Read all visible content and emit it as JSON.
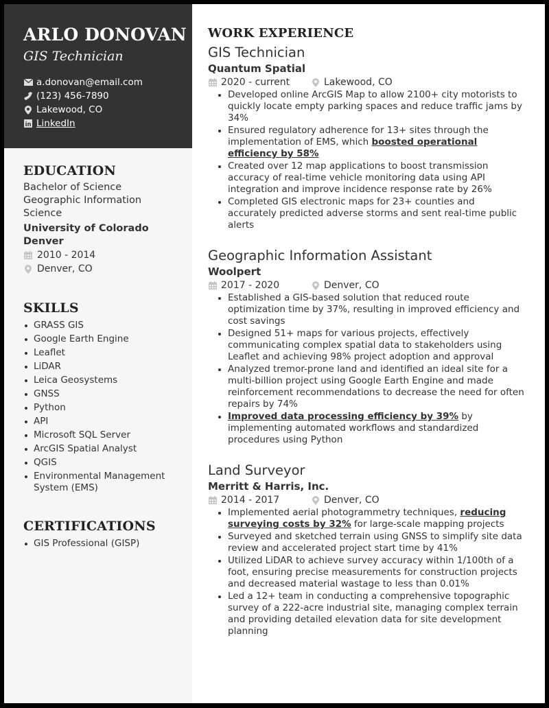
{
  "header": {
    "name": "ARLO DONOVAN",
    "role": "GIS Technician",
    "contacts": [
      {
        "icon": "envelope-icon",
        "text": "a.donovan@email.com"
      },
      {
        "icon": "phone-icon",
        "text": "(123) 456-7890"
      },
      {
        "icon": "location-pin-icon",
        "text": "Lakewood, CO"
      },
      {
        "icon": "linkedin-icon",
        "text": "LinkedIn"
      }
    ]
  },
  "education": {
    "title": "EDUCATION",
    "degree": "Bachelor of Science",
    "field": "Geographic Information Science",
    "school": "University of Colorado Denver",
    "dates": "2010 - 2014",
    "location": "Denver, CO"
  },
  "skills": {
    "title": "SKILLS",
    "items": [
      "GRASS GIS",
      "Google Earth Engine",
      "Leaflet",
      "LiDAR",
      "Leica Geosystems",
      "GNSS",
      "Python",
      "API",
      "Microsoft SQL Server",
      "ArcGIS Spatial Analyst",
      "QGIS",
      "Environmental Management System (EMS)"
    ]
  },
  "certifications": {
    "title": "CERTIFICATIONS",
    "items": [
      "GIS Professional (GISP)"
    ]
  },
  "experience": {
    "title": "WORK EXPERIENCE",
    "jobs": [
      {
        "title": "GIS Technician",
        "company": "Quantum Spatial",
        "dates": "2020 - current",
        "location": "Lakewood, CO",
        "bullets": [
          {
            "pre": "Developed online ArcGIS Map to allow 2100+ city motorists to quickly locate empty parking spaces and reduce traffic jams by 34%",
            "hl": "",
            "post": ""
          },
          {
            "pre": "Ensured regulatory adherence for 13+ sites through the implementation of EMS, which ",
            "hl": "boosted operational efficiency by 58%",
            "post": ""
          },
          {
            "pre": "Created over 12 map applications to boost transmission accuracy of real-time vehicle monitoring data using API integration and improve incidence response rate by 26%",
            "hl": "",
            "post": ""
          },
          {
            "pre": "Completed GIS electronic maps for 23+ counties and accurately predicted adverse storms and sent real-time public alerts",
            "hl": "",
            "post": ""
          }
        ]
      },
      {
        "title": "Geographic Information Assistant",
        "company": "Woolpert",
        "dates": "2017 - 2020",
        "location": "Denver, CO",
        "bullets": [
          {
            "pre": "Established a GIS-based solution that reduced route optimization time by 37%, resulting in improved efficiency and cost savings",
            "hl": "",
            "post": ""
          },
          {
            "pre": "Designed 51+ maps for various projects, effectively communicating complex spatial data to stakeholders using Leaflet and achieving 98% project adoption and approval",
            "hl": "",
            "post": ""
          },
          {
            "pre": "Analyzed tremor-prone land and identified an ideal site for a multi-billion project using Google Earth Engine and made reinforcement recommendations to decrease the need for often repairs by 74%",
            "hl": "",
            "post": ""
          },
          {
            "pre": "",
            "hl": "Improved data processing efficiency by 39%",
            "post": " by implementing automated workflows and standardized procedures using Python"
          }
        ]
      },
      {
        "title": "Land Surveyor",
        "company": "Merritt & Harris, Inc.",
        "dates": "2014 - 2017",
        "location": "Denver, CO",
        "bullets": [
          {
            "pre": "Implemented aerial photogrammetry techniques, ",
            "hl": "reducing surveying costs by 32%",
            "post": " for large-scale mapping projects"
          },
          {
            "pre": "Surveyed and sketched terrain using GNSS to simplify site data review and accelerated project start time by 41%",
            "hl": "",
            "post": ""
          },
          {
            "pre": "Utilized LiDAR to achieve survey accuracy within 1/100th of a foot, ensuring precise measurements for construction projects and decreased material wastage to less than 0.01%",
            "hl": "",
            "post": ""
          },
          {
            "pre": "Led a 12+ team in conducting a comprehensive topographic survey of a 222-acre industrial site, managing complex terrain and providing detailed elevation data for site development planning",
            "hl": "",
            "post": ""
          }
        ]
      }
    ]
  },
  "colors": {
    "header_bg": "#333333",
    "sidebar_bg": "#f6f6f6",
    "text": "#333333",
    "icon_gray": "#c4c4c4"
  }
}
